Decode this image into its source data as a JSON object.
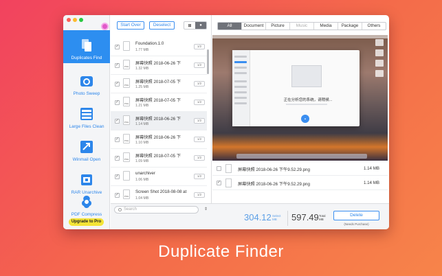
{
  "sidebar": {
    "items": [
      {
        "label": "Duplicates Find",
        "icon": "duplicate-files-icon",
        "active": true
      },
      {
        "label": "Photo Sweep",
        "icon": "camera-icon",
        "active": false
      },
      {
        "label": "Large Files Clean",
        "icon": "large-files-icon",
        "active": false
      },
      {
        "label": "Winmail Open",
        "icon": "winmail-icon",
        "active": false
      },
      {
        "label": "RAR Unarchive",
        "icon": "rar-archive-icon",
        "active": false
      },
      {
        "label": "PDF Compress",
        "icon": "pdf-compress-icon",
        "active": false
      }
    ],
    "upgrade_label": "Upgrade to Pro"
  },
  "toolbar": {
    "start_over_label": "Start Over",
    "deselect_label": "Deselect"
  },
  "file_list": [
    {
      "name": "Foundation.1.0",
      "size": "1.77 MB",
      "checked": true,
      "count": "1/2",
      "type": "doc"
    },
    {
      "name": "屏幕快照 2018-06-26 下",
      "size": "1.32 MB",
      "checked": true,
      "count": "1/2",
      "type": "png"
    },
    {
      "name": "屏幕快照 2018-07-05 下",
      "size": "1.25 MB",
      "checked": true,
      "count": "1/2",
      "type": "png"
    },
    {
      "name": "屏幕快照 2018-07-05 下",
      "size": "1.21 MB",
      "checked": true,
      "count": "1/2",
      "type": "png"
    },
    {
      "name": "屏幕快照 2018-06-26 下",
      "size": "1.14 MB",
      "checked": true,
      "count": "1/2",
      "type": "png",
      "selected": true
    },
    {
      "name": "屏幕快照 2018-06-26 下",
      "size": "1.10 MB",
      "checked": true,
      "count": "1/2",
      "type": "png"
    },
    {
      "name": "屏幕快照 2018-07-05 下",
      "size": "1.09 MB",
      "checked": true,
      "count": "1/2",
      "type": "png"
    },
    {
      "name": "unarchiver",
      "size": "1.06 MB",
      "checked": true,
      "count": "1/2",
      "type": "doc"
    },
    {
      "name": "Screen Shot 2018-08-08 at",
      "size": "1.04 MB",
      "checked": true,
      "count": "1/2",
      "type": "png"
    }
  ],
  "filter_tabs": [
    {
      "label": "All",
      "state": "on"
    },
    {
      "label": "Document",
      "state": "normal"
    },
    {
      "label": "Picture",
      "state": "normal"
    },
    {
      "label": "Music",
      "state": "dim"
    },
    {
      "label": "Media",
      "state": "normal"
    },
    {
      "label": "Package",
      "state": "normal"
    },
    {
      "label": "Others",
      "state": "normal"
    }
  ],
  "preview": {
    "dialog_text": "正在分析您的系统，请稍候..."
  },
  "duplicates": [
    {
      "name": "屏幕快照 2018-06-26 下午9.52.29.png",
      "size": "1.14 MB",
      "checked": false
    },
    {
      "name": "屏幕快照 2018-06-26 下午9.52.29.png",
      "size": "1.14 MB",
      "checked": true
    }
  ],
  "bottom": {
    "search_placeholder": "Search",
    "select_value": "304.12",
    "select_label_1": "Select",
    "select_label_2": "MB",
    "total_value": "597.49",
    "total_label_1": "Total",
    "total_label_2": "MB",
    "delete_label": "Delete",
    "needs_purchase": "(Needs Purchase)"
  },
  "caption": "Duplicate Finder",
  "colors": {
    "accent": "#2d8ef0",
    "background_start": "#f2425f",
    "background_end": "#f7844a",
    "upgrade": "#f4e437"
  }
}
